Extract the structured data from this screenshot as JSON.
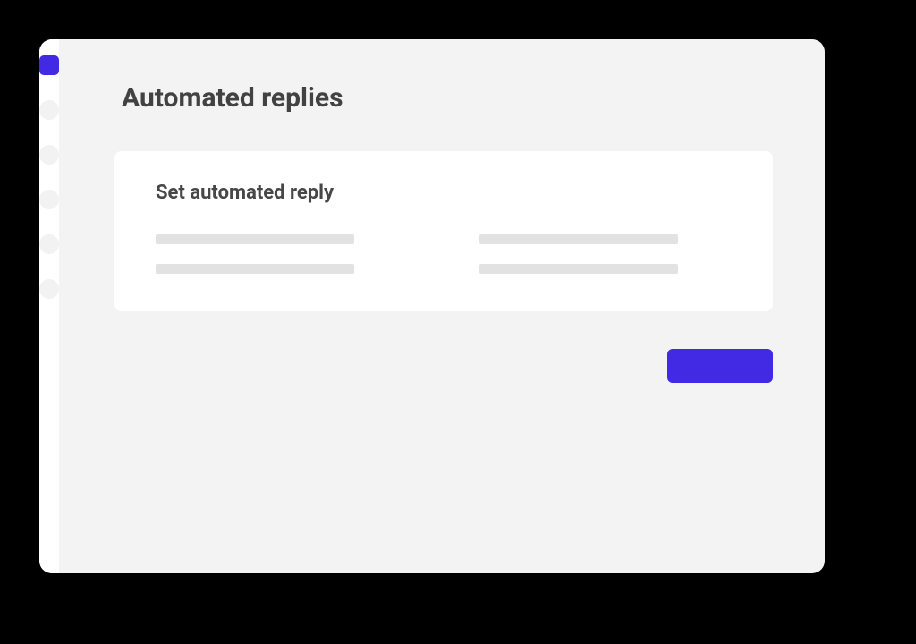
{
  "colors": {
    "accent": "#4229e3",
    "page_bg": "#f3f3f3",
    "card_bg": "#ffffff",
    "sidebar_bg": "#ffffff",
    "placeholder": "#e2e2e2",
    "title": "#424242",
    "subtitle": "#474747"
  },
  "sidebar": {
    "items": [
      {
        "active": true
      },
      {
        "active": false
      },
      {
        "active": false
      },
      {
        "active": false
      },
      {
        "active": false
      },
      {
        "active": false
      }
    ]
  },
  "page": {
    "title": "Automated replies"
  },
  "card": {
    "title": "Set automated reply"
  },
  "primary_button": {
    "label": ""
  }
}
